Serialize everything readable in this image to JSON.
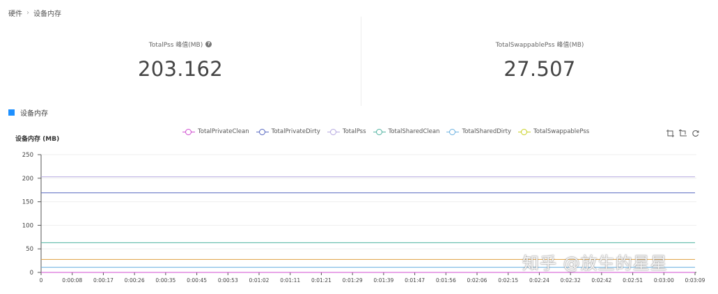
{
  "breadcrumb": {
    "root": "硬件",
    "current": "设备内存"
  },
  "stats": [
    {
      "label": "TotalPss 峰值(MB)",
      "value": "203.162",
      "help": true
    },
    {
      "label": "TotalSwappablePss 峰值(MB)",
      "value": "27.507",
      "help": false
    }
  ],
  "section": {
    "title": "设备内存",
    "color": "#1e90ff"
  },
  "toolbox": {
    "icons": [
      "zoom-icon",
      "zoom-reset-icon",
      "restore-icon"
    ]
  },
  "watermark": "知乎 @放生的星星",
  "chart_data": {
    "type": "line",
    "ylabel": "设备内存 (MB)",
    "ylim": [
      0,
      250
    ],
    "yticks": [
      0,
      50,
      100,
      150,
      200,
      250
    ],
    "grid": true,
    "legend_position": "top-center",
    "x": [
      "0",
      "0:00:08",
      "0:00:17",
      "0:00:26",
      "0:00:35",
      "0:00:45",
      "0:00:53",
      "0:01:02",
      "0:01:11",
      "0:01:21",
      "0:01:29",
      "0:01:39",
      "0:01:47",
      "0:01:56",
      "0:02:06",
      "0:02:15",
      "0:02:24",
      "0:02:32",
      "0:02:42",
      "0:02:51",
      "0:03:00",
      "0:03:09"
    ],
    "series": [
      {
        "name": "TotalPrivateClean",
        "color": "#d04bd0",
        "value": 0
      },
      {
        "name": "TotalPrivateDirty",
        "color": "#5566c0",
        "value": 169
      },
      {
        "name": "TotalPss",
        "color": "#b4a7e0",
        "value": 203
      },
      {
        "name": "TotalSharedClean",
        "color": "#4fb2a0",
        "value": 63
      },
      {
        "name": "TotalSharedDirty",
        "color": "#6ab0e0",
        "value": 11
      },
      {
        "name": "TotalSwappablePss",
        "color": "#c8d020",
        "value": 27.5
      }
    ],
    "extra_series_color": "#e0a040"
  }
}
